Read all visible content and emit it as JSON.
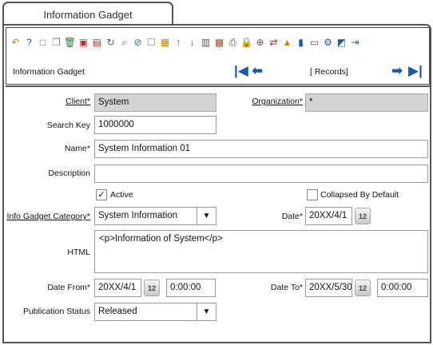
{
  "window": {
    "tab_title": "Information Gadget"
  },
  "toolbar": {
    "icons": [
      {
        "name": "undo-icon",
        "glyph": "↶",
        "color": "#c98a00"
      },
      {
        "name": "help-icon",
        "glyph": "?",
        "color": "#2a5fb0"
      },
      {
        "name": "new-record-icon",
        "glyph": "□",
        "color": "#777777"
      },
      {
        "name": "copy-record-icon",
        "glyph": "❐",
        "color": "#777777"
      },
      {
        "name": "delete-icon",
        "glyph": "🗑",
        "color": "#2e7d32"
      },
      {
        "name": "save-icon",
        "glyph": "▣",
        "color": "#b03030"
      },
      {
        "name": "save-new-icon",
        "glyph": "▤",
        "color": "#b03030"
      },
      {
        "name": "refresh-icon",
        "glyph": "↻",
        "color": "#2a5fb0"
      },
      {
        "name": "find-icon",
        "glyph": "⌕",
        "color": "#2a5fb0"
      },
      {
        "name": "attachment-icon",
        "glyph": "⊘",
        "color": "#2a5fb0"
      },
      {
        "name": "chat-icon",
        "glyph": "☐",
        "color": "#888888"
      },
      {
        "name": "grid-toggle-icon",
        "glyph": "▦",
        "color": "#c98a00"
      },
      {
        "name": "parent-record-icon",
        "glyph": "↑",
        "color": "#1c5aa8"
      },
      {
        "name": "detail-record-icon",
        "glyph": "↓",
        "color": "#1c5aa8"
      },
      {
        "name": "history-icon",
        "glyph": "▥",
        "color": "#555555"
      },
      {
        "name": "report-icon",
        "glyph": "▩",
        "color": "#a0522d"
      },
      {
        "name": "print-icon",
        "glyph": "⎙",
        "color": "#555555"
      },
      {
        "name": "lock-icon",
        "glyph": "🔒",
        "color": "#c98a00"
      },
      {
        "name": "zoom-across-icon",
        "glyph": "⊕",
        "color": "#555555"
      },
      {
        "name": "workflow-icon",
        "glyph": "⇄",
        "color": "#c62828"
      },
      {
        "name": "request-icon",
        "glyph": "▲",
        "color": "#c98a00"
      },
      {
        "name": "archive-icon",
        "glyph": "▮",
        "color": "#1c5aa8"
      },
      {
        "name": "product-info-icon",
        "glyph": "▭",
        "color": "#555555"
      },
      {
        "name": "settings-icon",
        "glyph": "⚙",
        "color": "#1c5aa8"
      },
      {
        "name": "translate-icon",
        "glyph": "◩",
        "color": "#1c5aa8"
      },
      {
        "name": "exit-icon",
        "glyph": "⇥",
        "color": "#2e7d32"
      }
    ],
    "gadget_title": "Information Gadget",
    "records_label": "[ Records]"
  },
  "form": {
    "client": {
      "label": "Client",
      "value": "System"
    },
    "organization": {
      "label": "Organization",
      "value": "*"
    },
    "search_key": {
      "label": "Search Key",
      "value": "1000000"
    },
    "name": {
      "label": "Name",
      "value": "System Information 01"
    },
    "description": {
      "label": "Description",
      "value": ""
    },
    "active": {
      "label": "Active",
      "checked": true
    },
    "collapsed_by_default": {
      "label": "Collapsed By Default",
      "checked": false
    },
    "info_gadget_category": {
      "label": "Info Gadget Category",
      "value": "System Information"
    },
    "date": {
      "label": "Date",
      "value": "20XX/4/1"
    },
    "html": {
      "label": "HTML",
      "value": "<p>Information of System</p>"
    },
    "date_from": {
      "label": "Date From",
      "date": "20XX/4/1",
      "time": "0:00:00"
    },
    "date_to": {
      "label": "Date To",
      "date": "20XX/5/30",
      "time": "0:00:00"
    },
    "publication_status": {
      "label": "Publication Status",
      "value": "Released"
    },
    "required_marker": "*",
    "calendar_glyph": "12"
  }
}
